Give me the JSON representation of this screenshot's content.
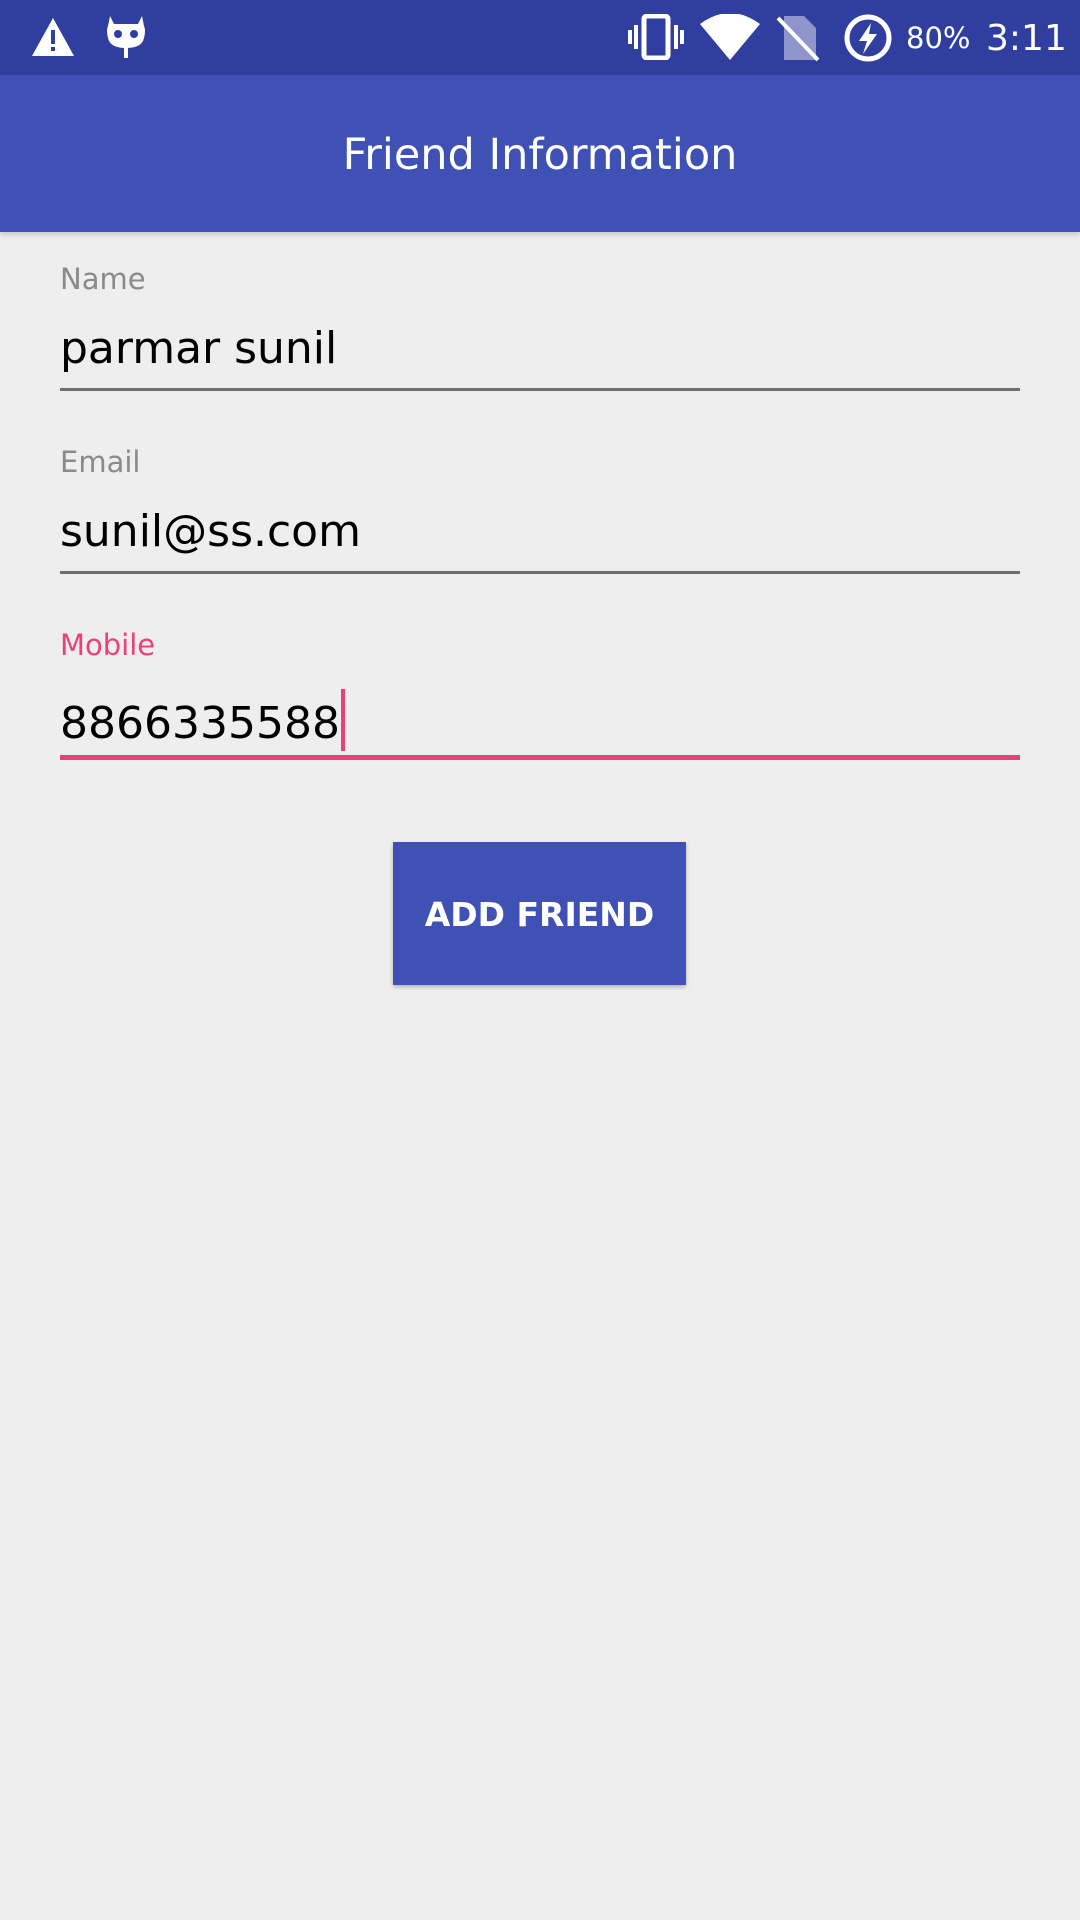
{
  "status_bar": {
    "icons": [
      "warning-icon",
      "cyanogen-mascot-icon",
      "vibrate-icon",
      "wifi-icon",
      "no-sim-icon",
      "battery-charging-icon"
    ],
    "battery_percent": "80%",
    "time": "3:11"
  },
  "app_bar": {
    "title": "Friend Information"
  },
  "form": {
    "name": {
      "label": "Name",
      "value": "parmar sunil"
    },
    "email": {
      "label": "Email",
      "value": "sunil@ss.com"
    },
    "mobile": {
      "label": "Mobile",
      "value": "8866335588",
      "focused": true
    }
  },
  "actions": {
    "add_friend_label": "ADD FRIEND"
  },
  "colors": {
    "primary": "#3f51b5",
    "primary_dark": "#303f9f",
    "accent": "#ec407a",
    "background": "#eeeeee"
  }
}
